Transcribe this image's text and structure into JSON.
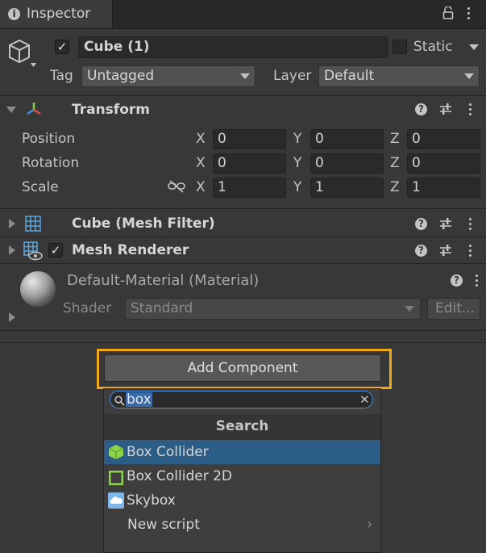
{
  "tab": {
    "title": "Inspector"
  },
  "object": {
    "name": "Cube (1)",
    "static_label": "Static",
    "tag_label": "Tag",
    "tag_value": "Untagged",
    "layer_label": "Layer",
    "layer_value": "Default",
    "active": true
  },
  "transform": {
    "title": "Transform",
    "rows": [
      {
        "label": "Position",
        "x": "0",
        "y": "0",
        "z": "0"
      },
      {
        "label": "Rotation",
        "x": "0",
        "y": "0",
        "z": "0"
      },
      {
        "label": "Scale",
        "x": "1",
        "y": "1",
        "z": "1"
      }
    ],
    "axes": {
      "x": "X",
      "y": "Y",
      "z": "Z"
    }
  },
  "mesh_filter": {
    "title": "Cube (Mesh Filter)"
  },
  "mesh_renderer": {
    "title": "Mesh Renderer",
    "enabled": true
  },
  "material": {
    "title": "Default-Material (Material)",
    "shader_label": "Shader",
    "shader_value": "Standard",
    "edit_label": "Edit..."
  },
  "add_component": {
    "button_label": "Add Component",
    "search_value": "box",
    "section_title": "Search",
    "results": [
      {
        "label": "Box Collider",
        "icon": "box-collider-icon",
        "selected": true
      },
      {
        "label": "Box Collider 2D",
        "icon": "box-collider-2d-icon",
        "selected": false
      },
      {
        "label": "Skybox",
        "icon": "skybox-icon",
        "selected": false
      },
      {
        "label": "New script",
        "icon": "",
        "selected": false
      }
    ]
  },
  "colors": {
    "background": "#383838",
    "highlight_frame": "#f0a81a",
    "selection": "#2c5d87",
    "search_focus": "#4a90d9",
    "collider_green": "#8ed34a"
  }
}
